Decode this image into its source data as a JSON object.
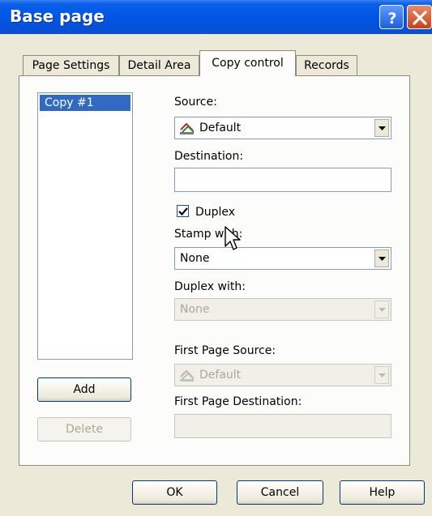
{
  "window": {
    "title": "Base page",
    "help_icon": "question-mark-icon",
    "close_icon": "close-x-icon"
  },
  "tabs": [
    {
      "label": "Page Settings",
      "active": false
    },
    {
      "label": "Detail Area",
      "active": false
    },
    {
      "label": "Copy control",
      "active": true
    },
    {
      "label": "Records",
      "active": false
    }
  ],
  "copies": {
    "items": [
      "Copy #1"
    ],
    "add_label": "Add",
    "delete_label": "Delete"
  },
  "form": {
    "source_label": "Source:",
    "source_value": "Default",
    "source_icon": "printer-tray-icon",
    "destination_label": "Destination:",
    "destination_value": "",
    "duplex_label": "Duplex",
    "duplex_checked": true,
    "stamp_with_label": "Stamp with:",
    "stamp_with_value": "None",
    "duplex_with_label": "Duplex with:",
    "duplex_with_value": "None",
    "first_page_source_label": "First Page Source:",
    "first_page_source_value": "Default",
    "first_page_destination_label": "First Page Destination:",
    "first_page_destination_value": ""
  },
  "footer": {
    "ok_label": "OK",
    "cancel_label": "Cancel",
    "help_label": "Help"
  },
  "colors": {
    "title_bar": "#0055e5",
    "selection": "#316ac5",
    "dialog_bg": "#ece9d8"
  }
}
